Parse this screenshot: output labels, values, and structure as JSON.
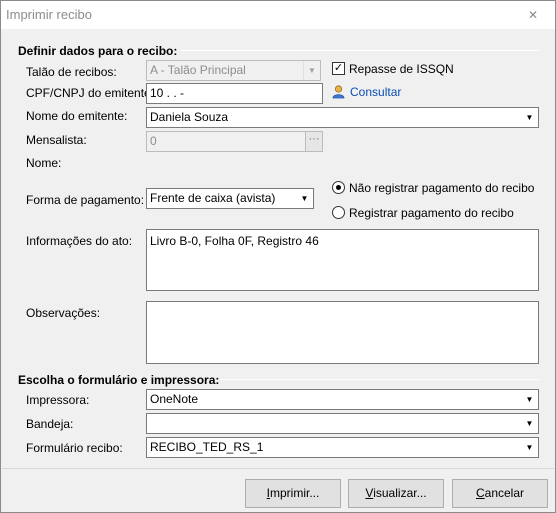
{
  "window": {
    "title": "Imprimir recibo",
    "close_glyph": "✕"
  },
  "recibo_section": {
    "title": "Definir dados para o recibo:",
    "talao": {
      "label": "Talão de recibos:",
      "value": "A - Talão Principal"
    },
    "repasse": {
      "label": "Repasse de ISSQN",
      "checked": true,
      "mark": "✓"
    },
    "cpf": {
      "label": "CPF/CNPJ do emitente:",
      "value": "10 .   .   -"
    },
    "consultar": {
      "label": "Consultar"
    },
    "nome_emitente": {
      "label": "Nome do emitente:",
      "value": "Daniela Souza"
    },
    "mensalista": {
      "label": "Mensalista:",
      "value": "0",
      "button": "···"
    },
    "nome": {
      "label": "Nome:",
      "value": ""
    },
    "forma_pagamento": {
      "label": "Forma de pagamento:",
      "value": "Frente de caixa (avista)"
    },
    "pagamento_options": [
      {
        "label": "Não registrar pagamento do recibo",
        "checked": true
      },
      {
        "label": "Registrar pagamento do recibo",
        "checked": false
      }
    ],
    "informacoes": {
      "label": "Informações do ato:",
      "value": "Livro B-0, Folha 0F, Registro 46"
    },
    "observacoes": {
      "label": "Observações:",
      "value": ""
    }
  },
  "impressora_section": {
    "title": "Escolha o formulário e impressora:",
    "impressora": {
      "label": "Impressora:",
      "value": "OneNote"
    },
    "bandeja": {
      "label": "Bandeja:",
      "value": ""
    },
    "formulario": {
      "label": "Formulário recibo:",
      "value": "RECIBO_TED_RS_1"
    }
  },
  "buttons": {
    "imprimir": {
      "underline": "I",
      "rest": "mprimir..."
    },
    "visualizar": {
      "underline": "V",
      "rest": "isualizar..."
    },
    "cancelar": {
      "underline": "C",
      "rest": "ancelar"
    }
  },
  "colors": {
    "link": "#0b4fb3",
    "title_text": "#8c8c8c",
    "dialog_bg": "#f0f0f0"
  }
}
